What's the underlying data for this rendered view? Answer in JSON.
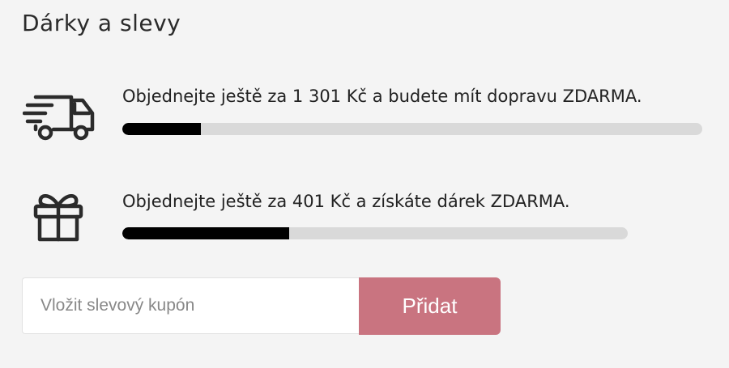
{
  "section": {
    "title": "Dárky a slevy"
  },
  "shipping": {
    "icon": "delivery-truck-icon",
    "text": "Objednejte ještě za 1 301 Kč a budete mít dopravu ZDARMA.",
    "progress": 0.135
  },
  "gift": {
    "icon": "gift-icon",
    "text": "Objednejte ještě za 401 Kč a získáte dárek ZDARMA.",
    "progress": 0.33
  },
  "coupon": {
    "placeholder": "Vložit slevový kupón",
    "value": "",
    "button_label": "Přidat"
  },
  "colors": {
    "background": "#f4f4f4",
    "progress_fill": "#000000",
    "progress_track": "#d9d9d9",
    "button_bg": "#c97480"
  }
}
